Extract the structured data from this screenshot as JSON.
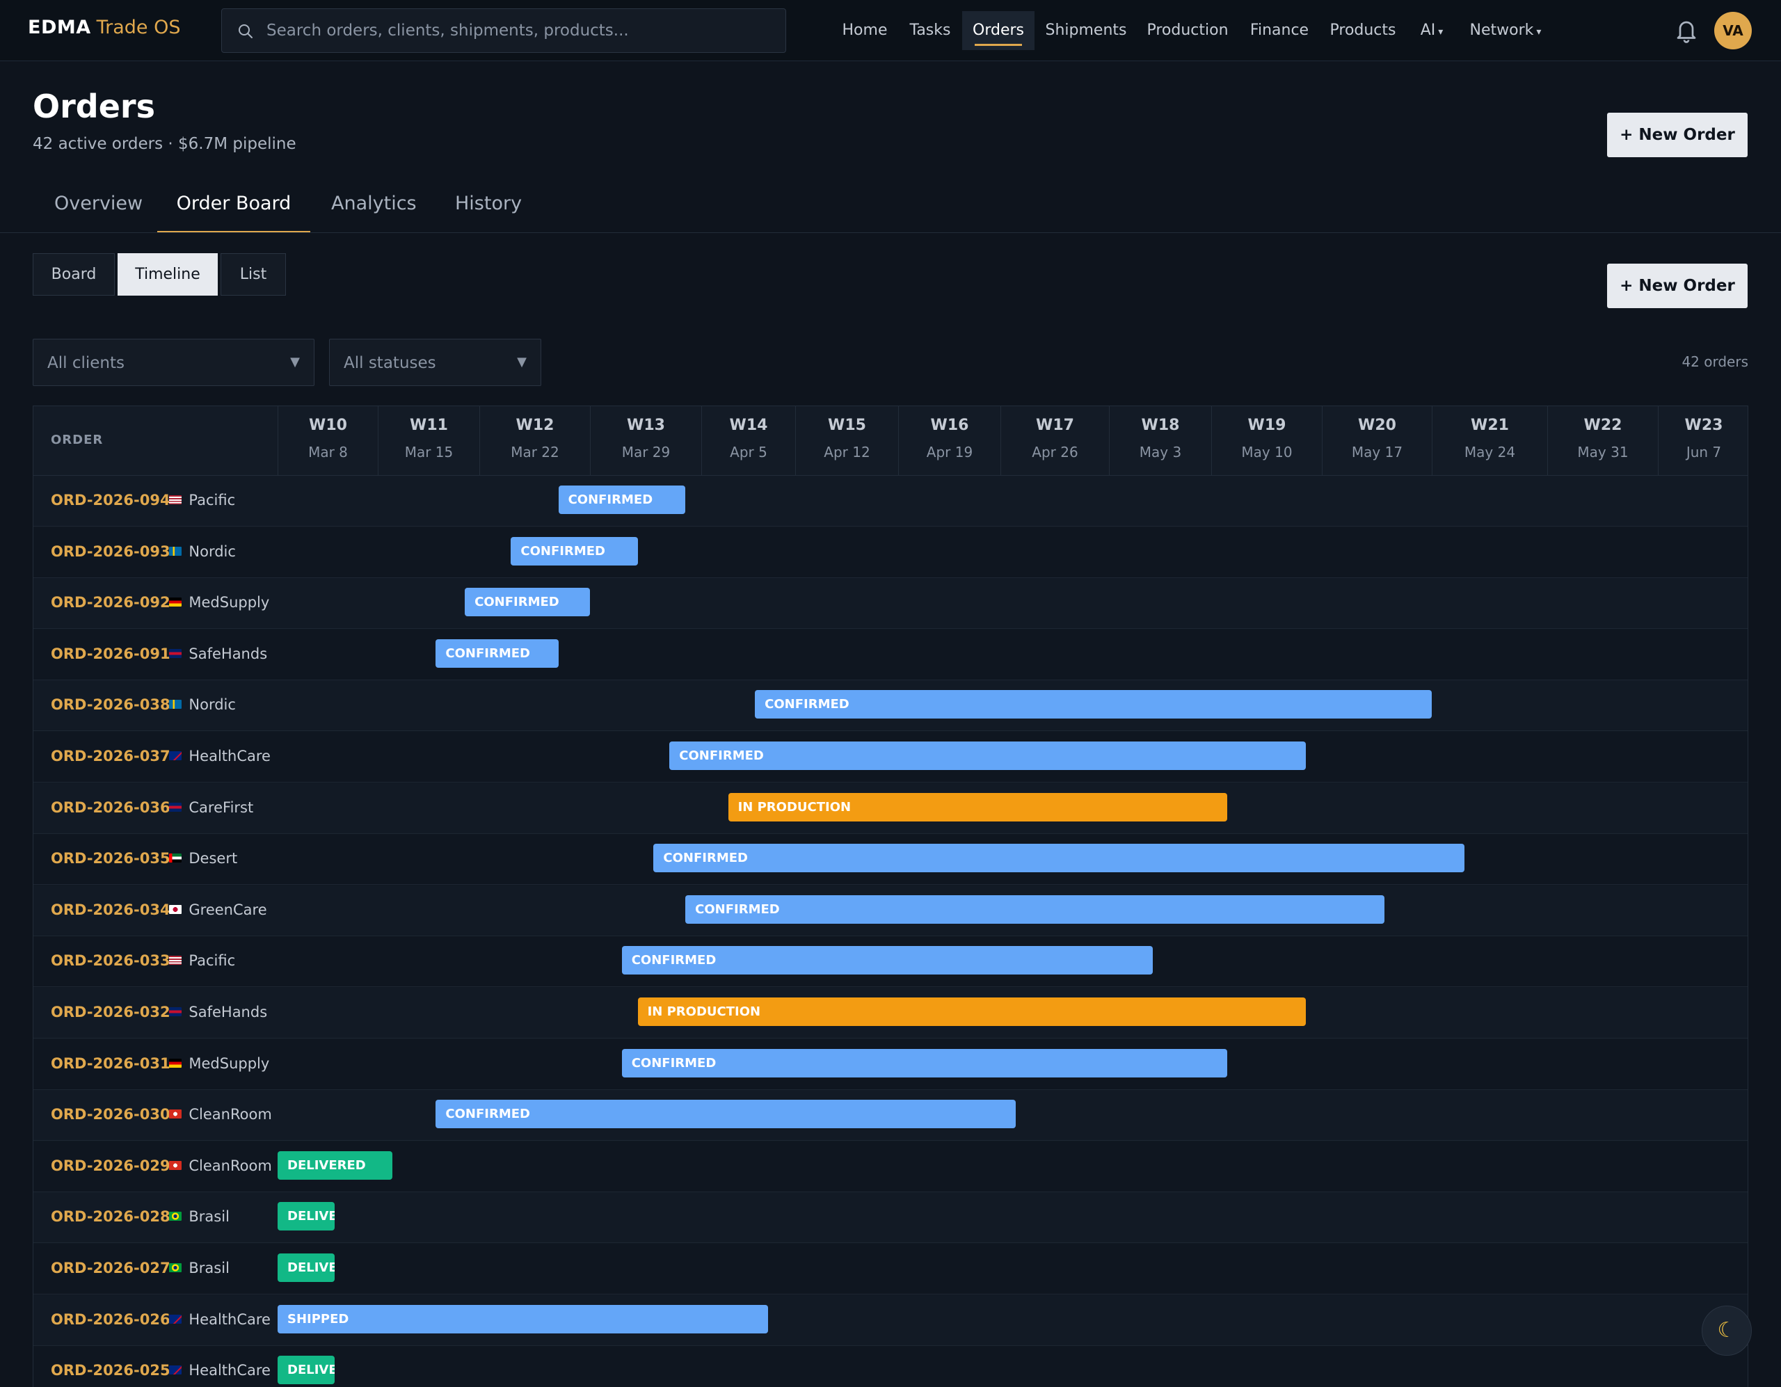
{
  "brand": {
    "name": "EDMA",
    "product": "Trade OS"
  },
  "search": {
    "placeholder": "Search orders, clients, shipments, products..."
  },
  "nav": [
    {
      "label": "Home",
      "active": false
    },
    {
      "label": "Tasks",
      "active": false
    },
    {
      "label": "Orders",
      "active": true
    },
    {
      "label": "Shipments",
      "active": false
    },
    {
      "label": "Production",
      "active": false
    },
    {
      "label": "Finance",
      "active": false
    },
    {
      "label": "Products",
      "active": false
    },
    {
      "label": "AI",
      "active": false,
      "dropdown": true
    },
    {
      "label": "Network",
      "active": false,
      "dropdown": true
    }
  ],
  "user": {
    "initials": "VA"
  },
  "page": {
    "title": "Orders",
    "subtitle": "42 active orders · $6.7M pipeline",
    "new_order_label": "+ New Order"
  },
  "tabs": [
    {
      "label": "Overview",
      "active": false
    },
    {
      "label": "Order Board",
      "active": true
    },
    {
      "label": "Analytics",
      "active": false
    },
    {
      "label": "History",
      "active": false
    }
  ],
  "view_toggle": [
    {
      "label": "Board",
      "active": false
    },
    {
      "label": "Timeline",
      "active": true
    },
    {
      "label": "List",
      "active": false
    }
  ],
  "filters": {
    "client": "All clients",
    "status": "All statuses",
    "count": "42 orders"
  },
  "timeline": {
    "order_column_label": "ORDER",
    "weeks": [
      {
        "week": "W10",
        "date": "Mar 8"
      },
      {
        "week": "W11",
        "date": "Mar 15"
      },
      {
        "week": "W12",
        "date": "Mar 22"
      },
      {
        "week": "W13",
        "date": "Mar 29"
      },
      {
        "week": "W14",
        "date": "Apr 5"
      },
      {
        "week": "W15",
        "date": "Apr 12"
      },
      {
        "week": "W16",
        "date": "Apr 19"
      },
      {
        "week": "W17",
        "date": "Apr 26"
      },
      {
        "week": "W18",
        "date": "May 3"
      },
      {
        "week": "W19",
        "date": "May 10"
      },
      {
        "week": "W20",
        "date": "May 17"
      },
      {
        "week": "W21",
        "date": "May 24"
      },
      {
        "week": "W22",
        "date": "May 31"
      },
      {
        "week": "W23",
        "date": "Jun 7"
      }
    ],
    "status_colors": {
      "CONFIRMED": "#64a6f8",
      "SHIPPED": "#64a6f8",
      "IN PRODUCTION": "#f39c12",
      "DELIVERED": "#12b886"
    },
    "orders": [
      {
        "id": "ORD-2026-094",
        "flag": "us",
        "client": "Pacific",
        "status": "CONFIRMED",
        "start": "Mar 27",
        "end": "Apr 4"
      },
      {
        "id": "ORD-2026-093",
        "flag": "se",
        "client": "Nordic",
        "status": "CONFIRMED",
        "start": "Mar 24",
        "end": "Apr 1"
      },
      {
        "id": "ORD-2026-092",
        "flag": "de",
        "client": "MedSupply",
        "status": "CONFIRMED",
        "start": "Mar 21",
        "end": "Mar 29"
      },
      {
        "id": "ORD-2026-091",
        "flag": "gb",
        "client": "SafeHands",
        "status": "CONFIRMED",
        "start": "Mar 19",
        "end": "Mar 27"
      },
      {
        "id": "ORD-2026-038",
        "flag": "se",
        "client": "Nordic",
        "status": "CONFIRMED",
        "start": "Apr 9",
        "end": "May 24"
      },
      {
        "id": "ORD-2026-037",
        "flag": "au",
        "client": "HealthCare",
        "status": "CONFIRMED",
        "start": "Apr 3",
        "end": "May 16"
      },
      {
        "id": "ORD-2026-036",
        "flag": "gb",
        "client": "CareFirst",
        "status": "IN PRODUCTION",
        "start": "Apr 7",
        "end": "May 11"
      },
      {
        "id": "ORD-2026-035",
        "flag": "ae",
        "client": "Desert",
        "status": "CONFIRMED",
        "start": "Apr 2",
        "end": "May 26"
      },
      {
        "id": "ORD-2026-034",
        "flag": "jp",
        "client": "GreenCare",
        "status": "CONFIRMED",
        "start": "Apr 4",
        "end": "May 21"
      },
      {
        "id": "ORD-2026-033",
        "flag": "us",
        "client": "Pacific",
        "status": "CONFIRMED",
        "start": "Mar 31",
        "end": "May 6"
      },
      {
        "id": "ORD-2026-032",
        "flag": "gb",
        "client": "SafeHands",
        "status": "IN PRODUCTION",
        "start": "Apr 1",
        "end": "May 16"
      },
      {
        "id": "ORD-2026-031",
        "flag": "de",
        "client": "MedSupply",
        "status": "CONFIRMED",
        "start": "Mar 31",
        "end": "May 11"
      },
      {
        "id": "ORD-2026-030",
        "flag": "ch",
        "client": "CleanRoom",
        "status": "CONFIRMED",
        "start": "Mar 19",
        "end": "Apr 27"
      },
      {
        "id": "ORD-2026-029",
        "flag": "ch",
        "client": "CleanRoom",
        "status": "DELIVERED",
        "start": "Mar 5",
        "end": "Mar 16"
      },
      {
        "id": "ORD-2026-028",
        "flag": "br",
        "client": "Brasil",
        "status": "DELIVERED",
        "start": "Mar 5",
        "end": "Mar 12"
      },
      {
        "id": "ORD-2026-027",
        "flag": "br",
        "client": "Brasil",
        "status": "DELIVERED",
        "start": "Mar 5",
        "end": "Mar 12"
      },
      {
        "id": "ORD-2026-026",
        "flag": "au",
        "client": "HealthCare",
        "status": "SHIPPED",
        "start": "Mar 5",
        "end": "Apr 10"
      },
      {
        "id": "ORD-2026-025",
        "flag": "au",
        "client": "HealthCare",
        "status": "DELIVERED",
        "start": "Mar 5",
        "end": "Mar 12"
      }
    ]
  }
}
